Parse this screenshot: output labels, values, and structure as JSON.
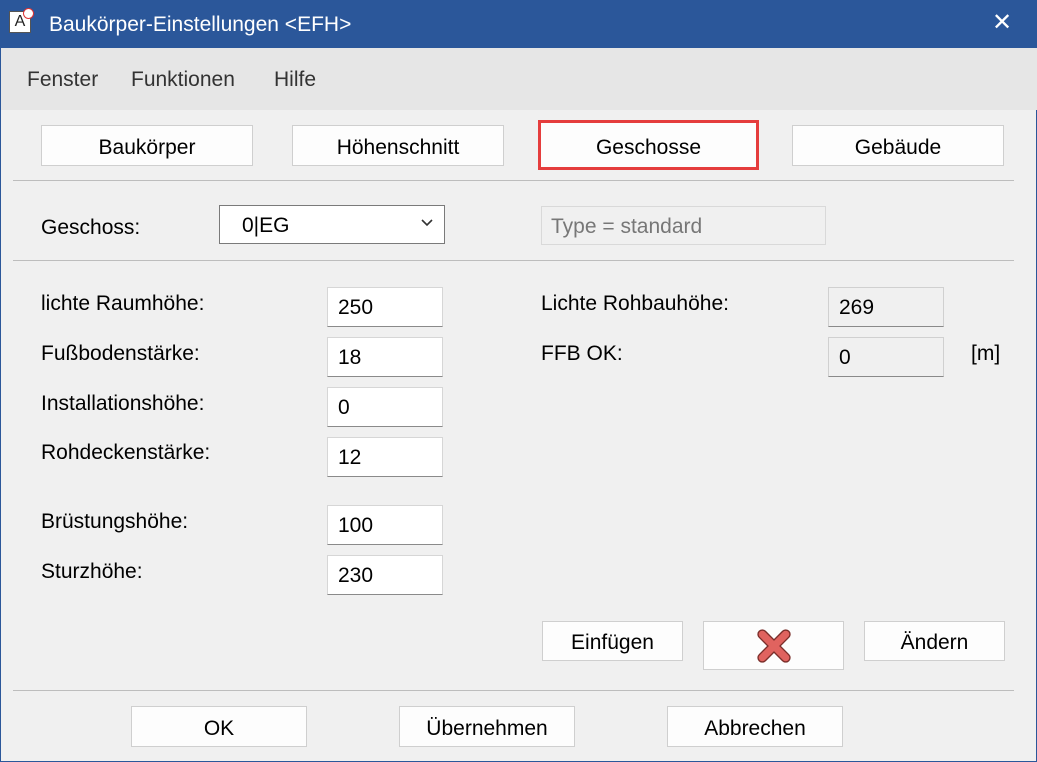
{
  "window": {
    "title": "Baukörper-Einstellungen <EFH>",
    "icon_letter": "A",
    "close_symbol": "✕"
  },
  "menu": [
    "Fenster",
    "Funktionen",
    "Hilfe"
  ],
  "tabs": {
    "baukoerper": "Baukörper",
    "hoehenschnitt": "Höhenschnitt",
    "geschosse": "Geschosse",
    "gebaeude": "Gebäude",
    "selected": "Geschosse",
    "selected_color": "#e53d3d"
  },
  "geschoss": {
    "label": "Geschoss:",
    "value": "0|EG",
    "type_placeholder": "Type = standard"
  },
  "fields": {
    "lichte_raumhoehe": {
      "label": "lichte Raumhöhe:",
      "value": "250"
    },
    "fussbodenstaerke": {
      "label": "Fußbodenstärke:",
      "value": "18"
    },
    "installationshoehe": {
      "label": "Installationshöhe:",
      "value": "0"
    },
    "rohdeckenstaerke": {
      "label": "Rohdeckenstärke:",
      "value": "12"
    },
    "bruestungshoehe": {
      "label": "Brüstungshöhe:",
      "value": "100"
    },
    "sturzhoehe": {
      "label": "Sturzhöhe:",
      "value": "230"
    }
  },
  "readonly": {
    "lichte_rohbauhoehe": {
      "label": "Lichte Rohbauhöhe:",
      "value": "269"
    },
    "ffb_ok": {
      "label": "FFB OK:",
      "value": "0",
      "unit": "[m]"
    }
  },
  "actions": {
    "einfuegen": "Einfügen",
    "delete_icon_color": "#e0635f",
    "aendern": "Ändern"
  },
  "footer": {
    "ok": "OK",
    "uebernehmen": "Übernehmen",
    "abbrechen": "Abbrechen"
  },
  "colors": {
    "titlebar": "#2b579a",
    "menubar": "#e6e6e6",
    "dialog_bg": "#f0f0f0"
  }
}
